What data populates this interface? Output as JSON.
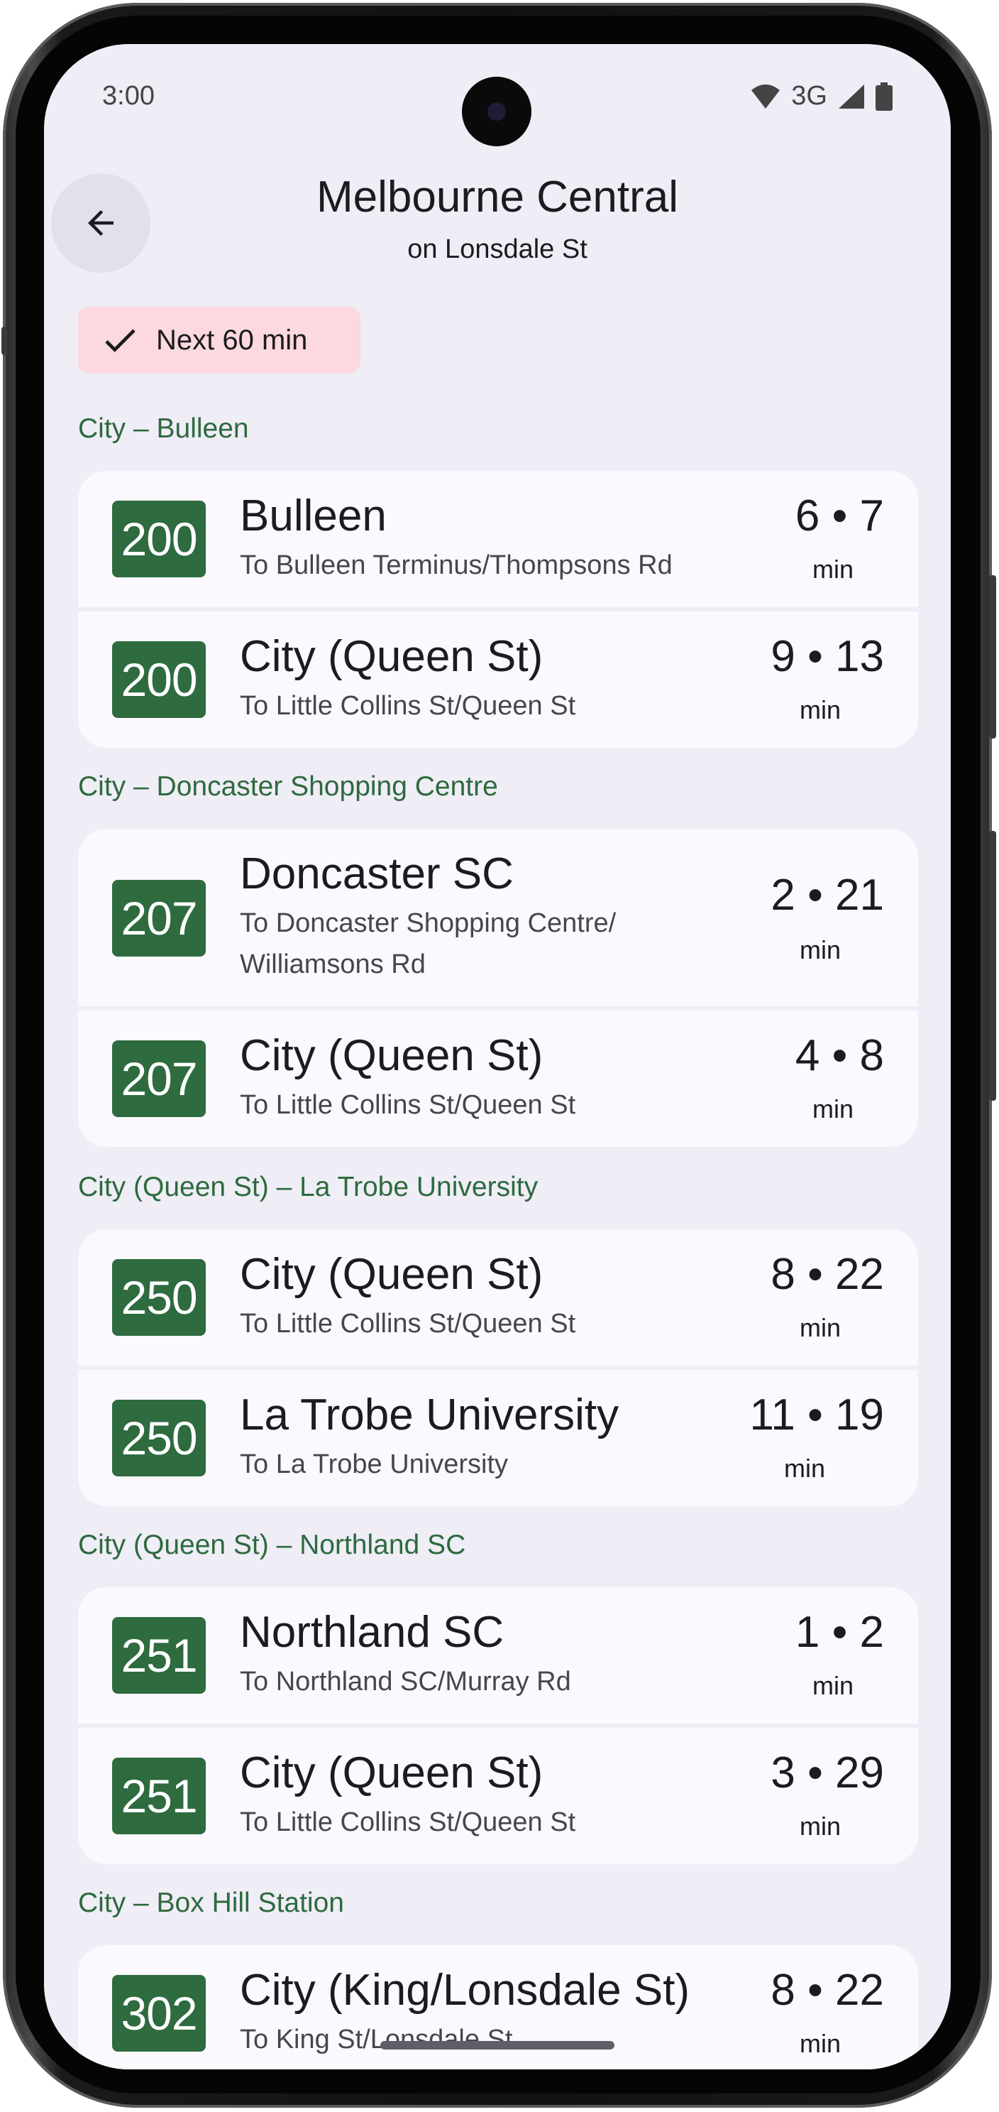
{
  "status_bar": {
    "time": "3:00",
    "network": "3G",
    "icons": [
      "wifi-icon",
      "signal-icon",
      "battery-icon"
    ]
  },
  "header": {
    "back_icon": "arrow-left-icon",
    "title": "Melbourne Central",
    "subtitle": "on Lonsdale St"
  },
  "filter_chip": {
    "icon": "check-icon",
    "label": "Next 60 min",
    "selected": true
  },
  "groups": [
    {
      "label": "City – Bulleen",
      "departures": [
        {
          "route": "200",
          "destination": "Bulleen",
          "via": "To Bulleen Terminus/Thompsons Rd",
          "times": "6 • 7",
          "unit": "min"
        },
        {
          "route": "200",
          "destination": "City (Queen St)",
          "via": "To Little Collins St/Queen St",
          "times": "9 • 13",
          "unit": "min"
        }
      ]
    },
    {
      "label": "City – Doncaster Shopping Centre",
      "departures": [
        {
          "route": "207",
          "destination": "Doncaster SC",
          "via": "To Doncaster Shopping Centre/ Williamsons Rd",
          "times": "2 • 21",
          "unit": "min"
        },
        {
          "route": "207",
          "destination": "City (Queen St)",
          "via": "To Little Collins St/Queen St",
          "times": "4 • 8",
          "unit": "min"
        }
      ]
    },
    {
      "label": "City (Queen St) – La Trobe University",
      "departures": [
        {
          "route": "250",
          "destination": "City (Queen St)",
          "via": "To Little Collins St/Queen St",
          "times": "8 • 22",
          "unit": "min"
        },
        {
          "route": "250",
          "destination": "La Trobe University",
          "via": "To La Trobe University",
          "times": "11 • 19",
          "unit": "min"
        }
      ]
    },
    {
      "label": "City (Queen St) – Northland SC",
      "departures": [
        {
          "route": "251",
          "destination": "Northland SC",
          "via": "To Northland SC/Murray Rd",
          "times": "1 • 2",
          "unit": "min"
        },
        {
          "route": "251",
          "destination": "City (Queen St)",
          "via": "To Little Collins St/Queen St",
          "times": "3 • 29",
          "unit": "min"
        }
      ]
    },
    {
      "label": "City – Box Hill Station",
      "departures": [
        {
          "route": "302",
          "destination": "City (King/Lonsdale St)",
          "via": "To King St/Lonsdale St",
          "times": "8 • 22",
          "unit": "min"
        }
      ]
    }
  ],
  "colors": {
    "background": "#efedf6",
    "card": "#fbf9fe",
    "route_badge": "#2e6b3f",
    "group_label": "#2d6a3e",
    "chip": "#fbd9de"
  }
}
